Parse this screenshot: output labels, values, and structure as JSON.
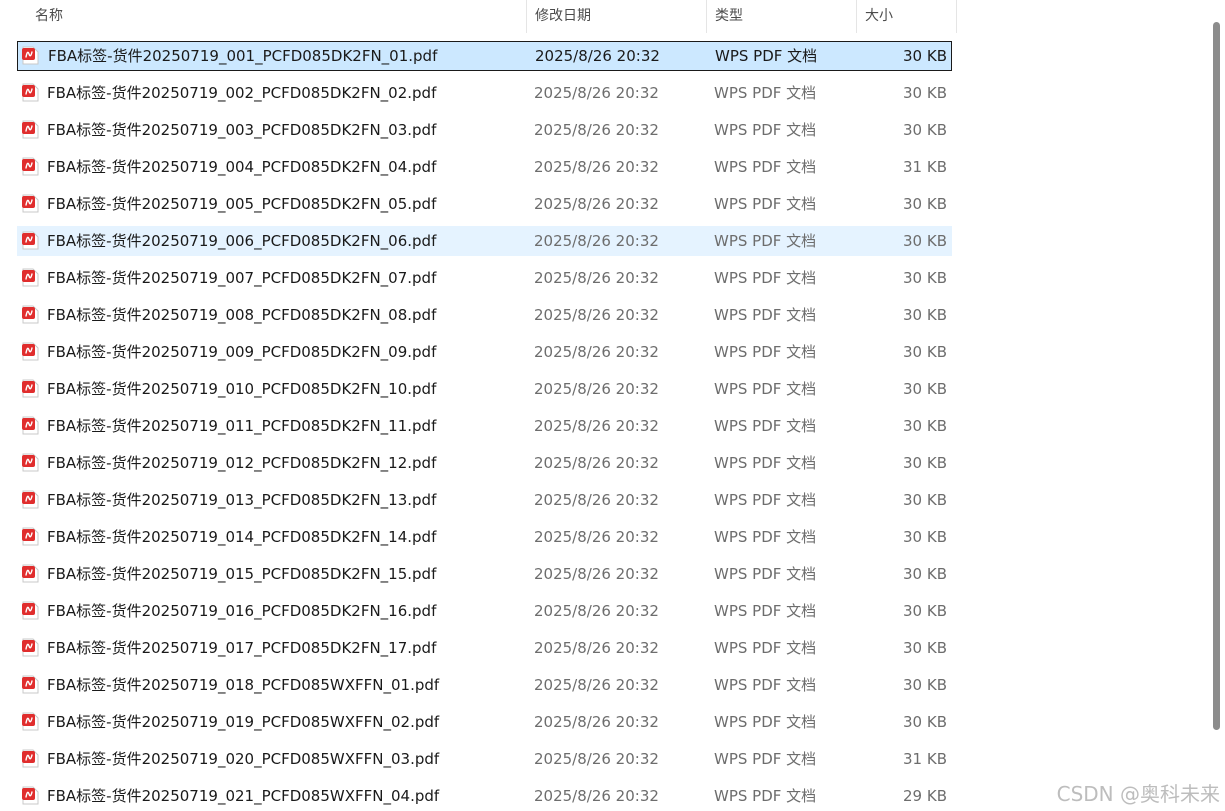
{
  "header": {
    "name": "名称",
    "date": "修改日期",
    "type": "类型",
    "size": "大小",
    "sort_arrow": "^"
  },
  "files": [
    {
      "name": "FBA标签-货件20250719_001_PCFD085DK2FN_01.pdf",
      "date": "2025/8/26 20:32",
      "type": "WPS PDF 文档",
      "size": "30 KB",
      "state": "selected"
    },
    {
      "name": "FBA标签-货件20250719_002_PCFD085DK2FN_02.pdf",
      "date": "2025/8/26 20:32",
      "type": "WPS PDF 文档",
      "size": "30 KB",
      "state": ""
    },
    {
      "name": "FBA标签-货件20250719_003_PCFD085DK2FN_03.pdf",
      "date": "2025/8/26 20:32",
      "type": "WPS PDF 文档",
      "size": "30 KB",
      "state": ""
    },
    {
      "name": "FBA标签-货件20250719_004_PCFD085DK2FN_04.pdf",
      "date": "2025/8/26 20:32",
      "type": "WPS PDF 文档",
      "size": "31 KB",
      "state": ""
    },
    {
      "name": "FBA标签-货件20250719_005_PCFD085DK2FN_05.pdf",
      "date": "2025/8/26 20:32",
      "type": "WPS PDF 文档",
      "size": "30 KB",
      "state": ""
    },
    {
      "name": "FBA标签-货件20250719_006_PCFD085DK2FN_06.pdf",
      "date": "2025/8/26 20:32",
      "type": "WPS PDF 文档",
      "size": "30 KB",
      "state": "hover"
    },
    {
      "name": "FBA标签-货件20250719_007_PCFD085DK2FN_07.pdf",
      "date": "2025/8/26 20:32",
      "type": "WPS PDF 文档",
      "size": "30 KB",
      "state": ""
    },
    {
      "name": "FBA标签-货件20250719_008_PCFD085DK2FN_08.pdf",
      "date": "2025/8/26 20:32",
      "type": "WPS PDF 文档",
      "size": "30 KB",
      "state": ""
    },
    {
      "name": "FBA标签-货件20250719_009_PCFD085DK2FN_09.pdf",
      "date": "2025/8/26 20:32",
      "type": "WPS PDF 文档",
      "size": "30 KB",
      "state": ""
    },
    {
      "name": "FBA标签-货件20250719_010_PCFD085DK2FN_10.pdf",
      "date": "2025/8/26 20:32",
      "type": "WPS PDF 文档",
      "size": "30 KB",
      "state": ""
    },
    {
      "name": "FBA标签-货件20250719_011_PCFD085DK2FN_11.pdf",
      "date": "2025/8/26 20:32",
      "type": "WPS PDF 文档",
      "size": "30 KB",
      "state": ""
    },
    {
      "name": "FBA标签-货件20250719_012_PCFD085DK2FN_12.pdf",
      "date": "2025/8/26 20:32",
      "type": "WPS PDF 文档",
      "size": "30 KB",
      "state": ""
    },
    {
      "name": "FBA标签-货件20250719_013_PCFD085DK2FN_13.pdf",
      "date": "2025/8/26 20:32",
      "type": "WPS PDF 文档",
      "size": "30 KB",
      "state": ""
    },
    {
      "name": "FBA标签-货件20250719_014_PCFD085DK2FN_14.pdf",
      "date": "2025/8/26 20:32",
      "type": "WPS PDF 文档",
      "size": "30 KB",
      "state": ""
    },
    {
      "name": "FBA标签-货件20250719_015_PCFD085DK2FN_15.pdf",
      "date": "2025/8/26 20:32",
      "type": "WPS PDF 文档",
      "size": "30 KB",
      "state": ""
    },
    {
      "name": "FBA标签-货件20250719_016_PCFD085DK2FN_16.pdf",
      "date": "2025/8/26 20:32",
      "type": "WPS PDF 文档",
      "size": "30 KB",
      "state": ""
    },
    {
      "name": "FBA标签-货件20250719_017_PCFD085DK2FN_17.pdf",
      "date": "2025/8/26 20:32",
      "type": "WPS PDF 文档",
      "size": "30 KB",
      "state": ""
    },
    {
      "name": "FBA标签-货件20250719_018_PCFD085WXFFN_01.pdf",
      "date": "2025/8/26 20:32",
      "type": "WPS PDF 文档",
      "size": "30 KB",
      "state": ""
    },
    {
      "name": "FBA标签-货件20250719_019_PCFD085WXFFN_02.pdf",
      "date": "2025/8/26 20:32",
      "type": "WPS PDF 文档",
      "size": "30 KB",
      "state": ""
    },
    {
      "name": "FBA标签-货件20250719_020_PCFD085WXFFN_03.pdf",
      "date": "2025/8/26 20:32",
      "type": "WPS PDF 文档",
      "size": "31 KB",
      "state": ""
    },
    {
      "name": "FBA标签-货件20250719_021_PCFD085WXFFN_04.pdf",
      "date": "2025/8/26 20:32",
      "type": "WPS PDF 文档",
      "size": "29 KB",
      "state": ""
    }
  ],
  "watermark": "CSDN @奥科未来",
  "colors": {
    "selected_bg": "#cce8ff",
    "hover_bg": "#e5f3ff",
    "pdf_icon": "#e02d2d"
  },
  "icons": {
    "file": "pdf-file-icon"
  }
}
